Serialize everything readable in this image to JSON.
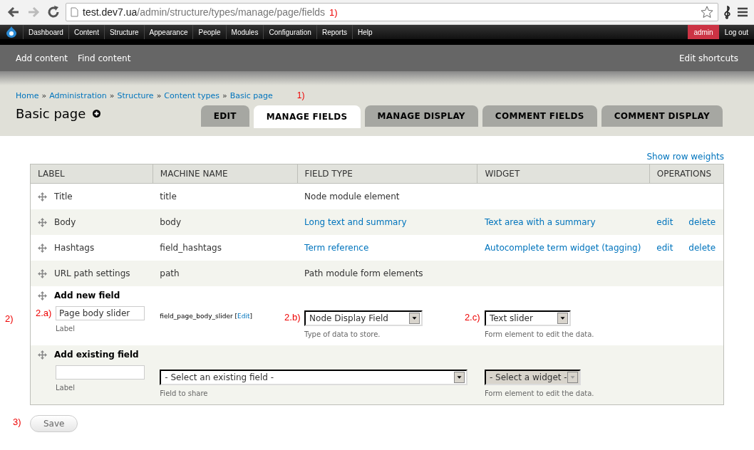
{
  "browser": {
    "url_host": "test.dev7.ua",
    "url_path": "/admin/structure/types/manage/page/fields",
    "url_annotation": "1)"
  },
  "toolbar": {
    "items": [
      "Dashboard",
      "Content",
      "Structure",
      "Appearance",
      "People",
      "Modules",
      "Configuration",
      "Reports",
      "Help"
    ],
    "user": "admin",
    "logout": "Log out"
  },
  "shortcuts": {
    "items": [
      "Add content",
      "Find content"
    ],
    "edit": "Edit shortcuts"
  },
  "breadcrumb": {
    "items": [
      "Home",
      "Administration",
      "Structure",
      "Content types",
      "Basic page"
    ],
    "separator": "»",
    "annotation": "1)"
  },
  "title": "Basic page",
  "tabs": [
    {
      "label": "EDIT",
      "selected": false
    },
    {
      "label": "MANAGE FIELDS",
      "selected": true
    },
    {
      "label": "MANAGE DISPLAY",
      "selected": false
    },
    {
      "label": "COMMENT FIELDS",
      "selected": false
    },
    {
      "label": "COMMENT DISPLAY",
      "selected": false
    }
  ],
  "show_row_weights": "Show row weights",
  "table": {
    "columns": [
      "LABEL",
      "MACHINE NAME",
      "FIELD TYPE",
      "WIDGET",
      "OPERATIONS"
    ],
    "rows": [
      {
        "label": "Title",
        "machine_name": "title",
        "field_type": "Node module element",
        "linked": false,
        "widget": "",
        "operations": []
      },
      {
        "label": "Body",
        "machine_name": "body",
        "field_type": "Long text and summary",
        "linked": true,
        "widget": "Text area with a summary",
        "operations": [
          "edit",
          "delete"
        ]
      },
      {
        "label": "Hashtags",
        "machine_name": "field_hashtags",
        "field_type": "Term reference",
        "linked": true,
        "widget": "Autocomplete term widget (tagging)",
        "operations": [
          "edit",
          "delete"
        ]
      },
      {
        "label": "URL path settings",
        "machine_name": "path",
        "field_type": "Path module form elements",
        "linked": false,
        "widget": "",
        "operations": []
      }
    ],
    "add_new": {
      "title": "Add new field",
      "annotation": "2)",
      "label_input": {
        "value": "Page body slider",
        "annotation": "2.a)",
        "description": "Label"
      },
      "machine_name": "field_page_body_slider",
      "machine_edit": "Edit",
      "edit_brackets": [
        "[",
        "]"
      ],
      "type_select": {
        "value": "Node Display Field",
        "annotation": "2.b)",
        "description": "Type of data to store."
      },
      "widget_select": {
        "value": "Text slider",
        "annotation": "2.c)",
        "description": "Form element to edit the data."
      }
    },
    "add_existing": {
      "title": "Add existing field",
      "label_input": {
        "description": "Label"
      },
      "field_select": {
        "value": "- Select an existing field -",
        "description": "Field to share"
      },
      "widget_select": {
        "value": "- Select a widget -",
        "description": "Form element to edit the data.",
        "disabled": true
      }
    }
  },
  "save": {
    "label": "Save",
    "annotation": "3)"
  }
}
